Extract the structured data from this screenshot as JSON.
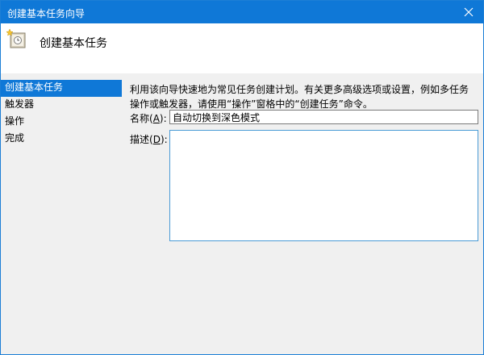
{
  "window": {
    "title": "创建基本任务向导",
    "close_icon": "close-icon"
  },
  "header": {
    "heading": "创建基本任务",
    "icon": "task-clock-icon"
  },
  "sidebar": {
    "items": [
      {
        "label": "创建基本任务",
        "active": true
      },
      {
        "label": "触发器",
        "active": false
      },
      {
        "label": "操作",
        "active": false
      },
      {
        "label": "完成",
        "active": false
      }
    ]
  },
  "main": {
    "description": "利用该向导快速地为常见任务创建计划。有关更多高级选项或设置，例如多任务操作或触发器，请使用“操作”窗格中的“创建任务”命令。",
    "name_label": "名称",
    "name_access_key": "A",
    "name_value": "自动切换到深色模式",
    "desc_label": "描述",
    "desc_access_key": "D",
    "desc_value": ""
  },
  "colors": {
    "accent": "#0f78d7",
    "background": "#f0f0f0"
  }
}
